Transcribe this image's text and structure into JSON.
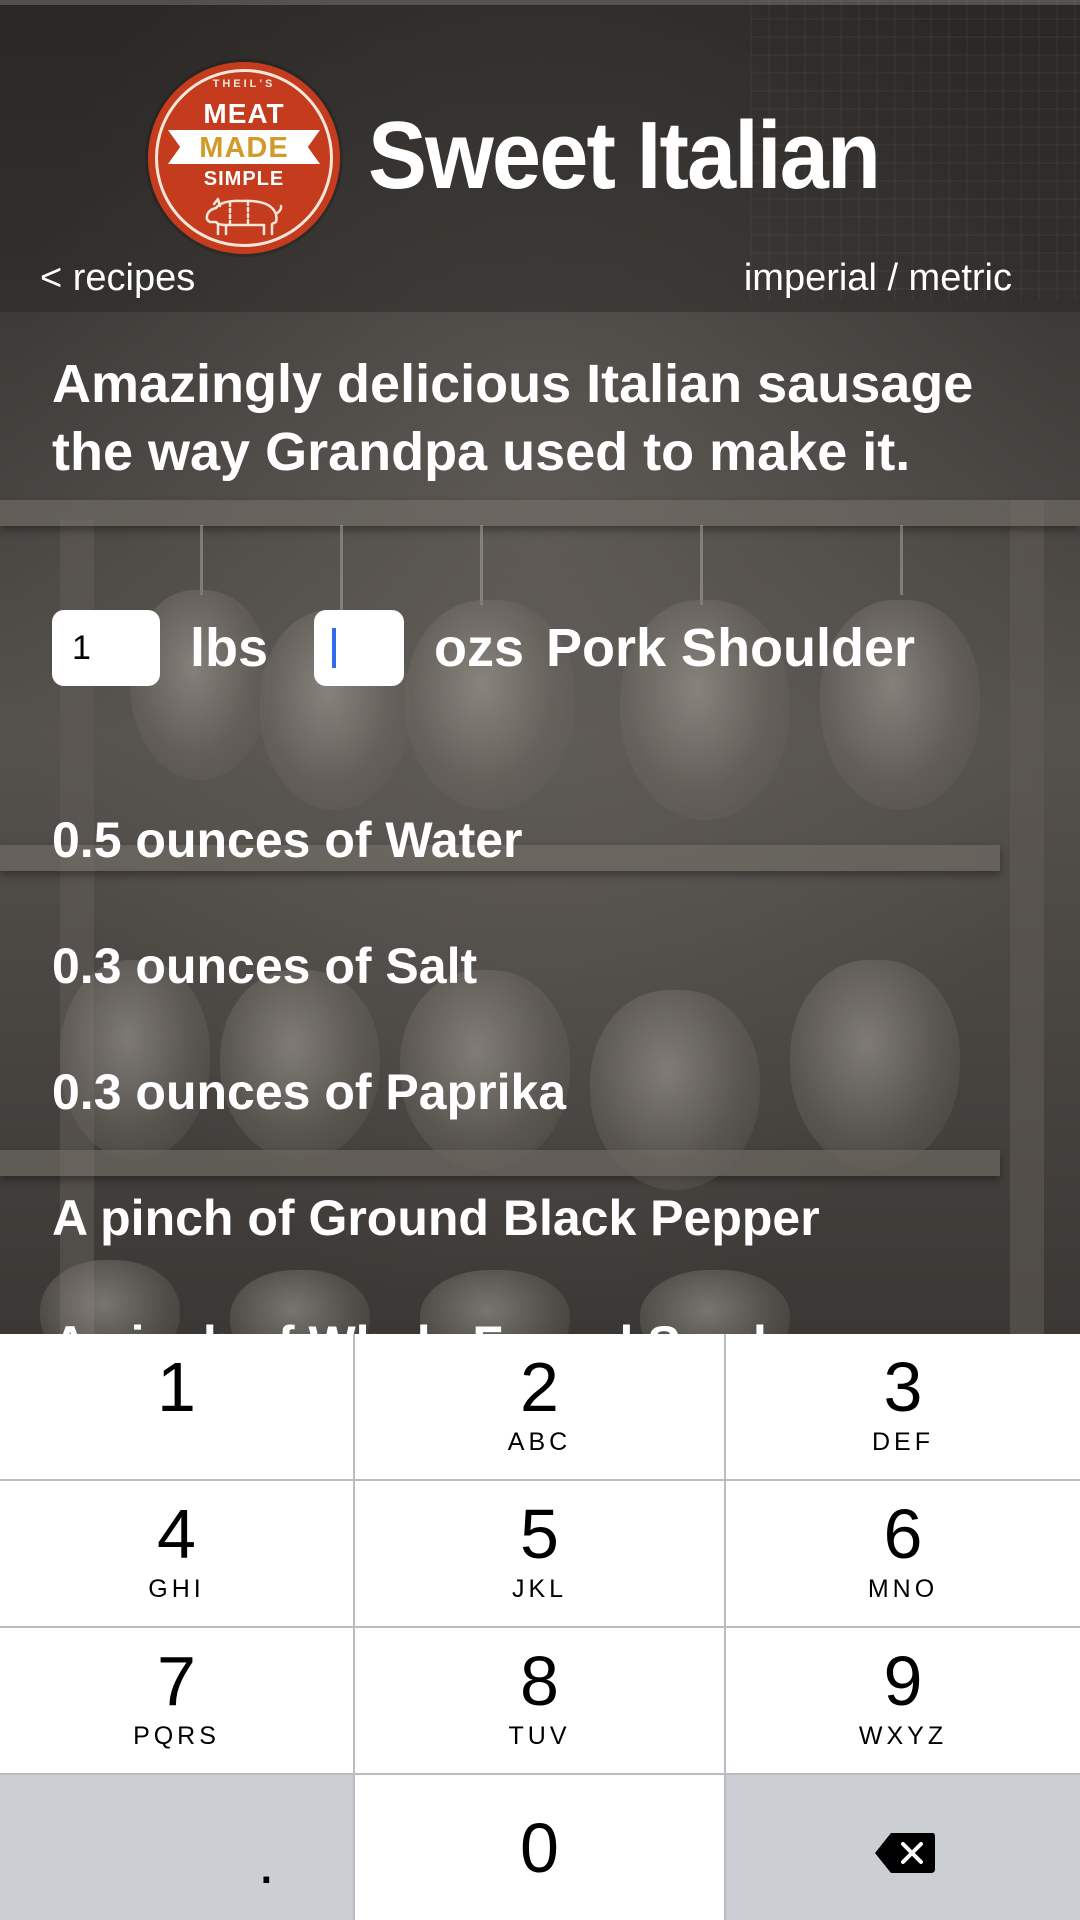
{
  "header": {
    "title": "Sweet Italian",
    "back_label": "< recipes",
    "units_label": "imperial / metric",
    "logo": {
      "top_text": "THEIL'S",
      "line1": "MEAT",
      "line2": "MADE",
      "line3": "SIMPLE",
      "red": "#c43c1d",
      "gold": "#d19a2a"
    }
  },
  "recipe": {
    "description": "Amazingly delicious Italian sausage the way Grandpa used to make it.",
    "quantity": {
      "lbs_value": "1",
      "lbs_label": "lbs",
      "ozs_value": "",
      "ozs_label": "ozs",
      "meat": "Pork Shoulder"
    },
    "ingredients": [
      "0.5 ounces of Water",
      "0.3 ounces of Salt",
      "0.3 ounces of Paprika",
      "A pinch of Ground Black Pepper",
      "A pinch of Whole Fennel Seeds"
    ]
  },
  "keypad": {
    "keys": [
      {
        "num": "1",
        "letters": ""
      },
      {
        "num": "2",
        "letters": "ABC"
      },
      {
        "num": "3",
        "letters": "DEF"
      },
      {
        "num": "4",
        "letters": "GHI"
      },
      {
        "num": "5",
        "letters": "JKL"
      },
      {
        "num": "6",
        "letters": "MNO"
      },
      {
        "num": "7",
        "letters": "PQRS"
      },
      {
        "num": "8",
        "letters": "TUV"
      },
      {
        "num": "9",
        "letters": "WXYZ"
      }
    ],
    "decimal": ".",
    "zero": "0",
    "backspace_icon": "backspace-icon",
    "caret_color": "#2f6bea"
  }
}
